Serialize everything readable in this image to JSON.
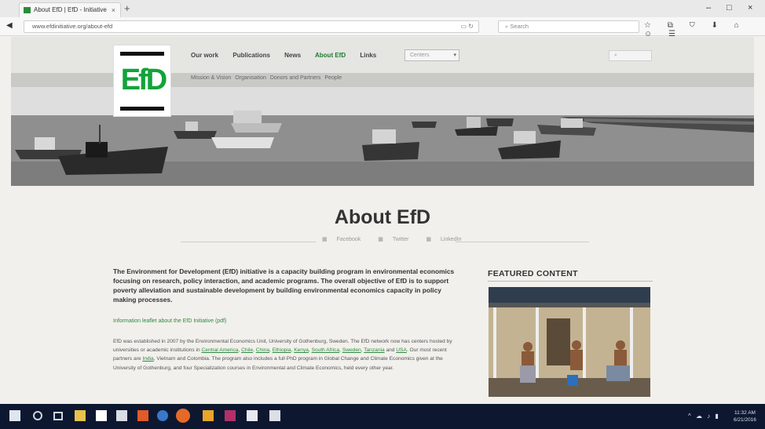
{
  "browser": {
    "tab_title": "About EfD | EfD - Initiative",
    "tab_close": "×",
    "new_tab": "+",
    "url": "www.efdinitiative.org/about-efd",
    "search_placeholder": "Search",
    "window_controls": {
      "minimize": "–",
      "maximize": "□",
      "close": "×"
    },
    "back": "◀",
    "url_icons": "▭  ↻",
    "toolbar_icons": "☆ ⧉ ⛉ ⬇ ⌂ ☺ ☰"
  },
  "site": {
    "logo_text": "EfD",
    "nav": [
      "Our work",
      "Publications",
      "News",
      "About EfD",
      "Links"
    ],
    "nav_active": "About EfD",
    "nav_select": "Centers",
    "nav_select_arrow": "▾",
    "search_icon": "🔍",
    "subnav": [
      "Mission & Vision",
      "Organisation",
      "Donors and Partners",
      "People"
    ]
  },
  "page": {
    "title": "About EfD",
    "share": [
      "Facebook",
      "Twitter",
      "LinkedIn"
    ],
    "intro": "The Environment for Development (EfD) initiative is a capacity building program in environmental economics focusing on research, policy interaction, and academic programs. The overall objective of EfD is to support poverty alleviation and sustainable development by building environmental economics capacity in policy making processes.",
    "leaflet_link": "Information leaflet about the EfD Initiative (pdf)",
    "body_p1": "EfD was established in 2007 by the Environmental Economics Unit, University of Gothenburg, Sweden. The EfD network now has centers hosted by universities or academic institutions in ",
    "body_links": [
      "Central America",
      "Chile",
      "China",
      "Ethiopia",
      "Kenya",
      "South Africa",
      "Sweden",
      "Tanzania",
      "USA",
      "India"
    ],
    "body_sep": ", ",
    "body_and": " and ",
    "body_p2": ". Our most recent partners are ",
    "body_p3": ", Vietnam and Colombia. The program also includes a full PhD program in Global Change and Climate Economics given at the University of Gothenburg, and four Specialization courses in Environmental and Climate Economics, held every other year.",
    "featured_heading": "FEATURED CONTENT"
  },
  "taskbar": {
    "clock_time": "11:32 AM",
    "clock_date": "6/21/2016",
    "tray_icons": "^ ☁ ♪ ▮"
  },
  "colors": {
    "brand_green": "#12a33a",
    "link_green": "#2e8a3e",
    "taskbar": "#0d1830"
  }
}
